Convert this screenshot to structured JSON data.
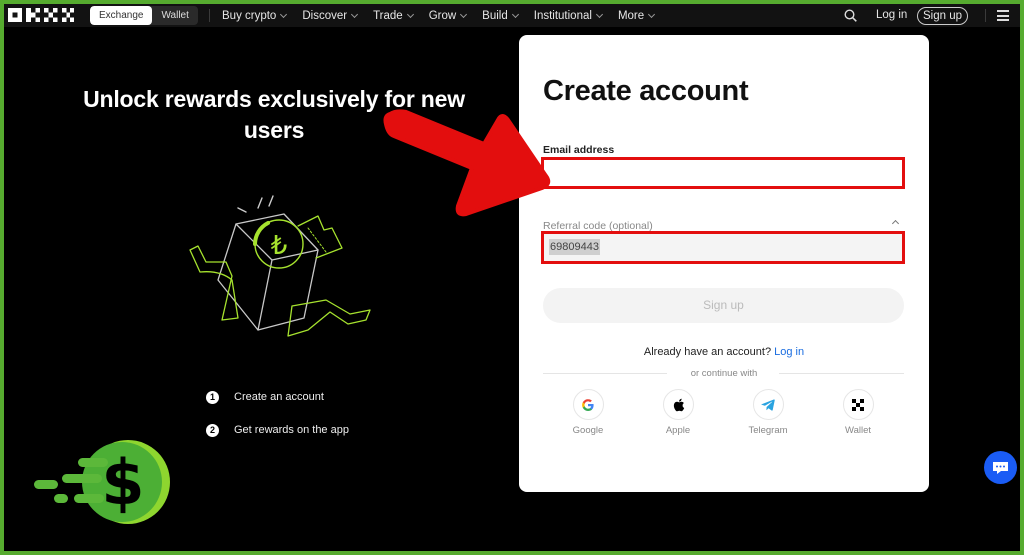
{
  "nav": {
    "segments": [
      "Exchange",
      "Wallet"
    ],
    "menu": [
      "Buy crypto",
      "Discover",
      "Trade",
      "Grow",
      "Build",
      "Institutional",
      "More"
    ],
    "login": "Log in",
    "signup": "Sign up"
  },
  "promo": {
    "headline": "Unlock rewards exclusively for new users",
    "steps": [
      {
        "num": "1",
        "text": "Create an account"
      },
      {
        "num": "2",
        "text": "Get rewards on the app"
      }
    ]
  },
  "form": {
    "title": "Create account",
    "email_label": "Email address",
    "email_value": "",
    "referral_label": "Referral code (optional)",
    "referral_value": "69809443",
    "signup_button": "Sign up",
    "already_text": "Already have an account?",
    "login_link": "Log in",
    "or_continue": "or continue with",
    "social": [
      {
        "name": "Google",
        "icon": "google-icon"
      },
      {
        "name": "Apple",
        "icon": "apple-icon"
      },
      {
        "name": "Telegram",
        "icon": "telegram-icon"
      },
      {
        "name": "Wallet",
        "icon": "wallet-icon"
      }
    ]
  },
  "colors": {
    "frame_border": "#56ab2f",
    "annotation_red": "#e30e0e",
    "link_blue": "#1a6de0",
    "accent_lime": "#a6e22e",
    "chat_blue": "#1a5cf5"
  }
}
